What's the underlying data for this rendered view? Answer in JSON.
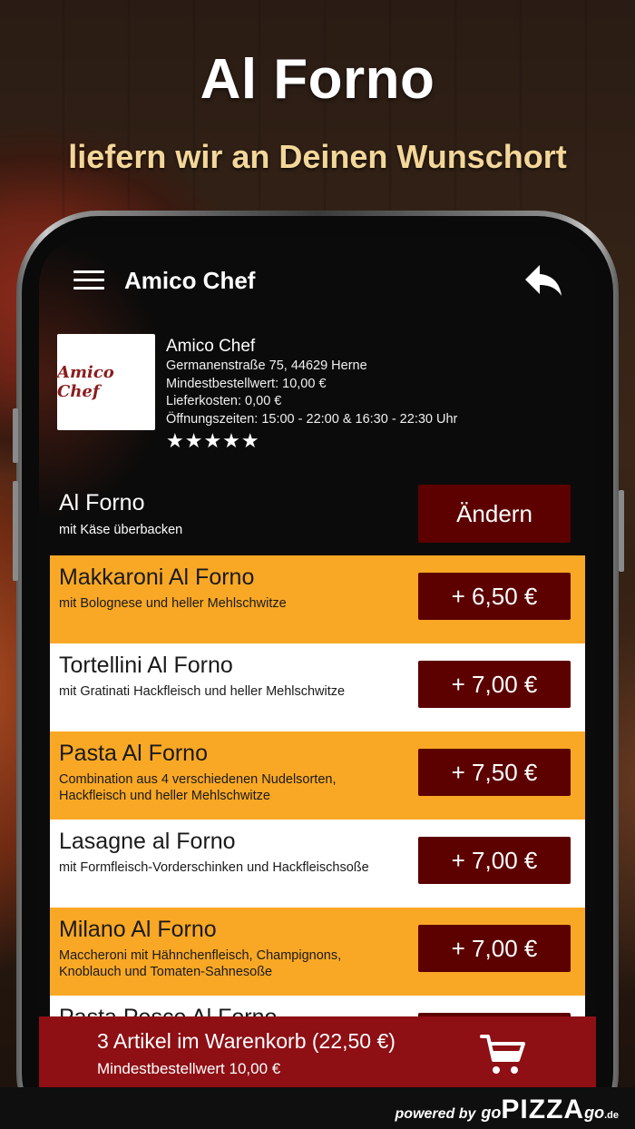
{
  "hero": {
    "title": "Al Forno",
    "subtitle": "liefern wir an Deinen Wunschort"
  },
  "appbar": {
    "title": "Amico Chef",
    "menu_icon": "hamburger-menu-icon",
    "back_icon": "reply-arrow-icon"
  },
  "restaurant": {
    "logo_text": "Amico Chef",
    "name": "Amico Chef",
    "address": "Germanenstraße 75, 44629 Herne",
    "min_order": "Mindestbestellwert: 10,00 €",
    "delivery": "Lieferkosten: 0,00 €",
    "hours": "Öffnungszeiten: 15:00 - 22:00 & 16:30 - 22:30 Uhr",
    "rating": 5,
    "stars": "★★★★★"
  },
  "category": {
    "title": "Al Forno",
    "subtitle": "mit Käse überbacken",
    "change_label": "Ändern"
  },
  "items": [
    {
      "name": "Makkaroni Al Forno",
      "desc": "mit Bolognese und heller Mehlschwitze",
      "price": "+ 6,50 €"
    },
    {
      "name": "Tortellini Al Forno",
      "desc": "mit Gratinati Hackfleisch und heller Mehlschwitze",
      "price": "+ 7,00 €"
    },
    {
      "name": "Pasta Al Forno",
      "desc": "Combination aus 4 verschiedenen Nudelsorten, Hackfleisch und heller Mehlschwitze",
      "price": "+ 7,50 €"
    },
    {
      "name": "Lasagne al Forno",
      "desc": "mit Formfleisch-Vorderschinken und Hackfleischsoße",
      "price": "+ 7,00 €"
    },
    {
      "name": "Milano Al Forno",
      "desc": "Maccheroni mit Hähnchenfleisch, Champignons, Knoblauch und Tomaten-Sahnesoße",
      "price": "+ 7,00 €"
    },
    {
      "name": "Pasta Pesce Al Forno",
      "desc": "",
      "price": ""
    }
  ],
  "cart": {
    "line1": "3 Artikel im Warenkorb (22,50 €)",
    "line2": "Mindestbestellwert 10,00 €",
    "icon": "shopping-cart-icon"
  },
  "footer": {
    "powered_by": "powered by",
    "brand_go": "go",
    "brand_pizza": "PIZZA",
    "brand_go2": "go",
    "brand_tld": ".de"
  },
  "colors": {
    "accent_orange": "#f9a825",
    "button_dark_red": "#5c0000",
    "cart_red": "#8e0f14",
    "hero_subtitle": "#f3d79a"
  }
}
